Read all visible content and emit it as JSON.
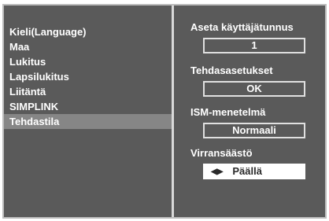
{
  "menu": {
    "items": [
      {
        "label": "Kieli(Language)"
      },
      {
        "label": "Maa"
      },
      {
        "label": "Lukitus"
      },
      {
        "label": "Lapsilukitus"
      },
      {
        "label": "Liitäntä"
      },
      {
        "label": "SIMPLINK"
      },
      {
        "label": "Tehdastila"
      }
    ],
    "selected": "Tehdastila"
  },
  "settings": {
    "user_id": {
      "label": "Aseta käyttäjätunnus",
      "value": "1"
    },
    "factory_reset": {
      "label": "Tehdasasetukset",
      "value": "OK"
    },
    "ism_method": {
      "label": "ISM-menetelmä",
      "value": "Normaali"
    },
    "power_saving": {
      "label": "Virransäästö",
      "value": "Päällä",
      "arrows_icon": "left-right-arrows-icon"
    }
  },
  "colors": {
    "background": "#5a5a5a",
    "highlight": "#868686",
    "text": "#ffffff",
    "active_box": "#ffffff"
  }
}
